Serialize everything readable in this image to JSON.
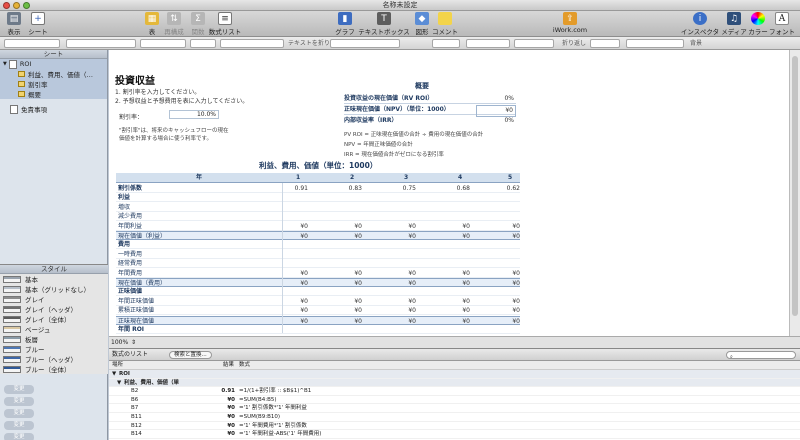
{
  "window": {
    "title": "名称未設定"
  },
  "toolbar": {
    "view": "表示",
    "sheet": "シート",
    "table": "表",
    "reorganize": "再構成",
    "function": "関数",
    "formula_list": "数式リスト",
    "chart": "グラフ",
    "textbox": "テキストボックス",
    "shape": "図形",
    "comment": "コメント",
    "iwork": "iWork.com",
    "inspector": "インスペクタ",
    "media": "メディア",
    "color": "カラー",
    "font": "フォント"
  },
  "formatbar": {
    "wrap": "折り返し",
    "wrap_text": "テキストを折り返す",
    "header_fill": "背景"
  },
  "sidebar": {
    "sheets_header": "シート",
    "sheets": [
      {
        "label": "ROI",
        "type": "sheet"
      },
      {
        "label": "利益、費用、価値（…",
        "type": "table"
      },
      {
        "label": "割引率",
        "type": "table"
      },
      {
        "label": "概要",
        "type": "table"
      },
      {
        "label": "免責事項",
        "type": "sheet"
      }
    ],
    "styles_header": "スタイル",
    "styles": [
      {
        "label": "基本",
        "color": "#9aa3ae"
      },
      {
        "label": "基本（グリッドなし）",
        "color": "#b7bfc9"
      },
      {
        "label": "グレイ",
        "color": "#8c8c8c"
      },
      {
        "label": "グレイ（ヘッダ）",
        "color": "#6f6f6f"
      },
      {
        "label": "グレイ（全体）",
        "color": "#5c5c5c"
      },
      {
        "label": "ベージュ",
        "color": "#d9c7a2"
      },
      {
        "label": "板層",
        "color": "#8a9ba8"
      },
      {
        "label": "ブルー",
        "color": "#4f78b4"
      },
      {
        "label": "ブルー（ヘッダ）",
        "color": "#3f67a6"
      },
      {
        "label": "ブルー（全体）",
        "color": "#2f5896"
      }
    ]
  },
  "document": {
    "title": "投資収益",
    "instructions": [
      "1. 割引率を入力してください。",
      "2. 予想収益と予想費用を表に入力してください。"
    ],
    "discount_label": "割引率：",
    "discount_value": "10.0%",
    "note": "\"割引率\"は、将来のキャッシュフローの現在価値を計算する場合に使う利率です。",
    "summary": {
      "title": "概要",
      "rows": [
        {
          "label": "投資収益の現在価値（RV ROI）",
          "value": "0%"
        },
        {
          "label": "正味現在価値（NPV）（単位：1000）",
          "value": "¥0"
        },
        {
          "label": "内部収益率（IRR）",
          "value": "0%"
        }
      ],
      "notes": [
        "PV ROI = 正味現在価値の合計 ÷ 費用の現在価値の合計",
        "NPV = 年間正味価値の合計",
        "IRR = 現在価値合計がゼロになる割引率"
      ]
    },
    "table": {
      "title": "利益、費用、価値（単位：1000）",
      "header": [
        "年",
        "1",
        "2",
        "3",
        "4",
        "5"
      ],
      "rows": [
        {
          "label": "割引係数",
          "bold": true,
          "values": [
            "0.91",
            "0.83",
            "0.75",
            "0.68",
            "0.62"
          ]
        },
        {
          "label": "利益",
          "bold": true,
          "values": [
            "",
            "",
            "",
            "",
            ""
          ]
        },
        {
          "label": "増収",
          "values": [
            "",
            "",
            "",
            "",
            ""
          ]
        },
        {
          "label": "減少費用",
          "values": [
            "",
            "",
            "",
            "",
            ""
          ]
        },
        {
          "label": "年間利益",
          "values": [
            "¥0",
            "¥0",
            "¥0",
            "¥0",
            "¥0"
          ]
        },
        {
          "label": "現在価値（利益）",
          "hl": true,
          "values": [
            "¥0",
            "¥0",
            "¥0",
            "¥0",
            "¥0"
          ]
        },
        {
          "label": "費用",
          "bold": true,
          "values": [
            "",
            "",
            "",
            "",
            ""
          ]
        },
        {
          "label": "一時費用",
          "values": [
            "",
            "",
            "",
            "",
            ""
          ]
        },
        {
          "label": "経常費用",
          "values": [
            "",
            "",
            "",
            "",
            ""
          ]
        },
        {
          "label": "年間費用",
          "values": [
            "¥0",
            "¥0",
            "¥0",
            "¥0",
            "¥0"
          ]
        },
        {
          "label": "現在価値（費用）",
          "hl": true,
          "values": [
            "¥0",
            "¥0",
            "¥0",
            "¥0",
            "¥0"
          ]
        },
        {
          "label": "正味価値",
          "bold": true,
          "values": [
            "",
            "",
            "",
            "",
            ""
          ]
        },
        {
          "label": "年間正味価値",
          "values": [
            "¥0",
            "¥0",
            "¥0",
            "¥0",
            "¥0"
          ]
        },
        {
          "label": "累積正味価値",
          "values": [
            "¥0",
            "¥0",
            "¥0",
            "¥0",
            "¥0"
          ]
        },
        {
          "label": "正味現在価値",
          "hl": true,
          "values": [
            "¥0",
            "¥0",
            "¥0",
            "¥0",
            "¥0"
          ]
        },
        {
          "label": "年間 ROI",
          "bold": true,
          "values": [
            "",
            "",
            "",
            "",
            ""
          ]
        }
      ]
    }
  },
  "statusbar": {
    "zoom": "100%"
  },
  "formula_list": {
    "title": "数式のリスト",
    "find_replace": "検索と置換...",
    "columns": [
      "場所",
      "結果",
      "数式"
    ],
    "groups": [
      "ROI",
      "利益、費用、価値（単"
    ],
    "rows": [
      {
        "loc": "B2",
        "result": "0.91",
        "formula": "=1/(1+割引率 :: $B$1)^B1"
      },
      {
        "loc": "B6",
        "result": "¥0",
        "formula": "=SUM(B4:B5)"
      },
      {
        "loc": "B7",
        "result": "¥0",
        "formula": "='1' 割引係数*'1' 年間利益"
      },
      {
        "loc": "B11",
        "result": "¥0",
        "formula": "=SUM(B9:B10)"
      },
      {
        "loc": "B12",
        "result": "¥0",
        "formula": "='1' 年間費用*'1' 割引係数"
      },
      {
        "loc": "B14",
        "result": "¥0",
        "formula": "='1' 年間利益-ABS('1' 年間費用)"
      }
    ]
  },
  "review_items": [
    "変更",
    "変更",
    "変更",
    "変更",
    "変更"
  ]
}
